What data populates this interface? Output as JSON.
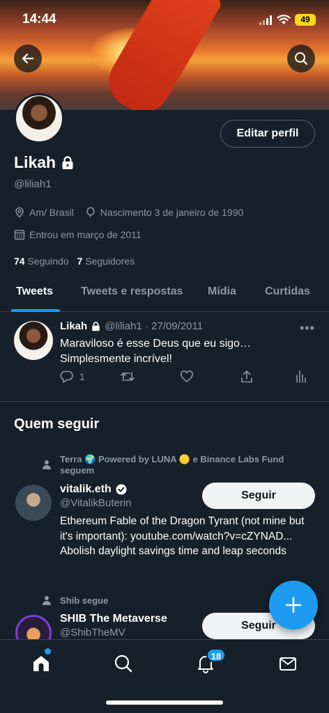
{
  "status": {
    "time": "14:44",
    "battery": "49"
  },
  "profile": {
    "name": "Likah",
    "handle": "@liliah1",
    "location": "Am/ Brasil",
    "birthday": "Nascimento 3 de janeiro de 1990",
    "joined": "Entrou em março de 2011",
    "following_count": "74",
    "following_label": "Seguindo",
    "followers_count": "7",
    "followers_label": "Seguidores",
    "edit_label": "Editar perfil"
  },
  "tabs": [
    {
      "label": "Tweets"
    },
    {
      "label": "Tweets e respostas"
    },
    {
      "label": "Mídia"
    },
    {
      "label": "Curtidas"
    }
  ],
  "tweet": {
    "name": "Likah",
    "meta": "@liliah1 · 27/09/2011",
    "text": "Maraviloso é esse Deus que eu sigo… Simplesmente incrível!",
    "reply_count": "1"
  },
  "who_to_follow": {
    "title": "Quem seguir",
    "suggestions": [
      {
        "context": "Terra 🌍 Powered by LUNA 🟡 e Binance Labs Fund seguem",
        "name": "vitalik.eth",
        "handle": "@VitalikButerin",
        "follow_label": "Seguir",
        "bio": "Ethereum Fable of the Dragon Tyrant (not mine but it's important): youtube.com/watch?v=cZYNAD... Abolish daylight savings time and leap seconds"
      },
      {
        "context": "Shib segue",
        "name": "SHIB The Metaverse",
        "handle": "@ShibTheMV",
        "follow_label": "Seguir"
      }
    ]
  },
  "nav": {
    "notifications_badge": "18"
  },
  "colors": {
    "background": "#15202b",
    "accent": "#1d9bf0",
    "muted": "#8b98a5",
    "divider": "#38444d"
  }
}
